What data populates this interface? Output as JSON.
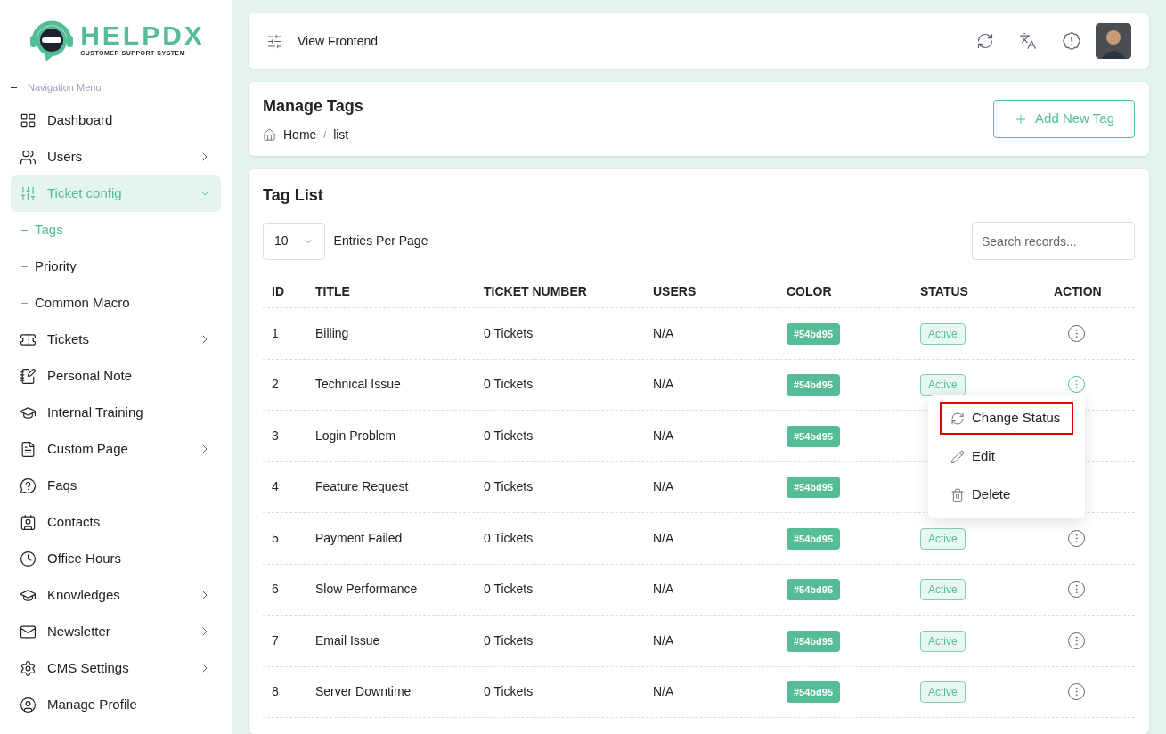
{
  "brand": {
    "name": "HELPDX",
    "tagline": "CUSTOMER SUPPORT SYSTEM"
  },
  "sidebar": {
    "section_title": "Navigation Menu",
    "items": [
      {
        "label": "Dashboard",
        "selected": false,
        "has_submenu": false
      },
      {
        "label": "Users",
        "selected": false,
        "has_submenu": true,
        "expanded": false
      },
      {
        "label": "Ticket config",
        "selected": true,
        "has_submenu": true,
        "expanded": true,
        "children": [
          {
            "label": "Tags",
            "selected": true
          },
          {
            "label": "Priority",
            "selected": false
          },
          {
            "label": "Common Macro",
            "selected": false
          }
        ]
      },
      {
        "label": "Tickets",
        "selected": false,
        "has_submenu": true,
        "expanded": false
      },
      {
        "label": "Personal Note",
        "selected": false,
        "has_submenu": false
      },
      {
        "label": "Internal Training",
        "selected": false,
        "has_submenu": false
      },
      {
        "label": "Custom Page",
        "selected": false,
        "has_submenu": true,
        "expanded": false
      },
      {
        "label": "Faqs",
        "selected": false,
        "has_submenu": false
      },
      {
        "label": "Contacts",
        "selected": false,
        "has_submenu": false
      },
      {
        "label": "Office Hours",
        "selected": false,
        "has_submenu": false
      },
      {
        "label": "Knowledges",
        "selected": false,
        "has_submenu": true,
        "expanded": false
      },
      {
        "label": "Newsletter",
        "selected": false,
        "has_submenu": true,
        "expanded": false
      },
      {
        "label": "CMS Settings",
        "selected": false,
        "has_submenu": true,
        "expanded": false
      },
      {
        "label": "Manage Profile",
        "selected": false,
        "has_submenu": false
      }
    ]
  },
  "topbar": {
    "link": "View Frontend"
  },
  "page_header": {
    "title": "Manage Tags",
    "breadcrumb": [
      "Home",
      "list"
    ],
    "breadcrumb_separator": "/",
    "button": "Add New Tag"
  },
  "tag_list": {
    "title": "Tag List",
    "entries_value": "10",
    "entries_label": "Entries Per Page",
    "search": {
      "placeholder": "Search records..."
    },
    "columns": [
      "ID",
      "TITLE",
      "TICKET NUMBER",
      "USERS",
      "COLOR",
      "STATUS",
      "ACTION"
    ],
    "rows": [
      {
        "id": "1",
        "title": "Billing",
        "tickets": "0 Tickets",
        "users": "N/A",
        "color_label": "#54bd95",
        "color": "#54bd95",
        "status": "Active",
        "menu_open": false
      },
      {
        "id": "2",
        "title": "Technical Issue",
        "tickets": "0 Tickets",
        "users": "N/A",
        "color_label": "#54bd95",
        "color": "#54bd95",
        "status": "Active",
        "menu_open": true
      },
      {
        "id": "3",
        "title": "Login Problem",
        "tickets": "0 Tickets",
        "users": "N/A",
        "color_label": "#54bd95",
        "color": "#54bd95"
      },
      {
        "id": "4",
        "title": "Feature Request",
        "tickets": "0 Tickets",
        "users": "N/A",
        "color_label": "#54bd95",
        "color": "#54bd95"
      },
      {
        "id": "5",
        "title": "Payment Failed",
        "tickets": "0 Tickets",
        "users": "N/A",
        "color_label": "#54bd95",
        "color": "#54bd95",
        "status": "Active",
        "menu_open": false
      },
      {
        "id": "6",
        "title": "Slow Performance",
        "tickets": "0 Tickets",
        "users": "N/A",
        "color_label": "#54bd95",
        "color": "#54bd95",
        "status": "Active",
        "menu_open": false
      },
      {
        "id": "7",
        "title": "Email Issue",
        "tickets": "0 Tickets",
        "users": "N/A",
        "color_label": "#54bd95",
        "color": "#54bd95",
        "status": "Active",
        "menu_open": false
      },
      {
        "id": "8",
        "title": "Server Downtime",
        "tickets": "0 Tickets",
        "users": "N/A",
        "color_label": "#54bd95",
        "color": "#54bd95",
        "status": "Active",
        "menu_open": false
      }
    ],
    "action_menu": [
      {
        "kind": "status",
        "label": "Change Status",
        "highlighted": true
      },
      {
        "kind": "edit",
        "label": "Edit",
        "highlighted": false
      },
      {
        "kind": "delete",
        "label": "Delete",
        "highlighted": false
      }
    ]
  }
}
